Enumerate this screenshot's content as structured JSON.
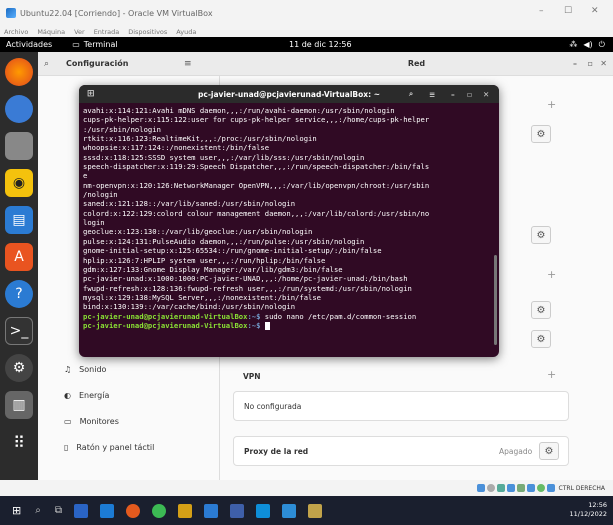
{
  "vbox": {
    "title": "Ubuntu22.04 [Corriendo] - Oracle VM VirtualBox",
    "menu": [
      "Archivo",
      "Máquina",
      "Ver",
      "Entrada",
      "Dispositivos",
      "Ayuda"
    ],
    "status_right": "CTRL DERECHA"
  },
  "gnome": {
    "activities": "Actividades",
    "app": "Terminal",
    "clock": "11 de dic  12:56"
  },
  "settings": {
    "left_title": "Configuración",
    "right_title": "Red",
    "sidebar": [
      "Sonido",
      "Energía",
      "Monitores",
      "Ratón y panel táctil"
    ],
    "vpn": {
      "title": "VPN",
      "status": "No configurada"
    },
    "proxy": {
      "title": "Proxy de la red",
      "status": "Apagado"
    }
  },
  "terminal": {
    "title": "pc-javier-unad@pcjavierunad-VirtualBox: ~",
    "lines": [
      "avahi:x:114:121:Avahi mDNS daemon,,,:/run/avahi-daemon:/usr/sbin/nologin",
      "cups-pk-helper:x:115:122:user for cups-pk-helper service,,,:/home/cups-pk-helper",
      ":/usr/sbin/nologin",
      "rtkit:x:116:123:RealtimeKit,,,:/proc:/usr/sbin/nologin",
      "whoopsie:x:117:124::/nonexistent:/bin/false",
      "sssd:x:118:125:SSSD system user,,,:/var/lib/sss:/usr/sbin/nologin",
      "speech-dispatcher:x:119:29:Speech Dispatcher,,,:/run/speech-dispatcher:/bin/fals",
      "e",
      "nm-openvpn:x:120:126:NetworkManager OpenVPN,,,:/var/lib/openvpn/chroot:/usr/sbin",
      "/nologin",
      "saned:x:121:128::/var/lib/saned:/usr/sbin/nologin",
      "colord:x:122:129:colord colour management daemon,,,:/var/lib/colord:/usr/sbin/no",
      "login",
      "geoclue:x:123:130::/var/lib/geoclue:/usr/sbin/nologin",
      "pulse:x:124:131:PulseAudio daemon,,,:/run/pulse:/usr/sbin/nologin",
      "gnome-initial-setup:x:125:65534::/run/gnome-initial-setup/:/bin/false",
      "hplip:x:126:7:HPLIP system user,,,:/run/hplip:/bin/false",
      "gdm:x:127:133:Gnome Display Manager:/var/lib/gdm3:/bin/false",
      "pc-javier-unad:x:1000:1000:PC-javier-UNAD,,,:/home/pc-javier-unad:/bin/bash",
      "fwupd-refresh:x:128:136:fwupd-refresh user,,,:/run/systemd:/usr/sbin/nologin",
      "mysql:x:129:138:MySQL Server,,,:/nonexistent:/bin/false",
      "bind:x:130:139::/var/cache/bind:/usr/sbin/nologin"
    ],
    "prompt_user": "pc-javier-unad@pcjavierunad-VirtualBox",
    "prompt_path": ":~$",
    "cmd1": " sudo nano /etc/pam.d/common-session",
    "cmd2": " "
  },
  "windows": {
    "time": "12:56",
    "date": "11/12/2022"
  }
}
